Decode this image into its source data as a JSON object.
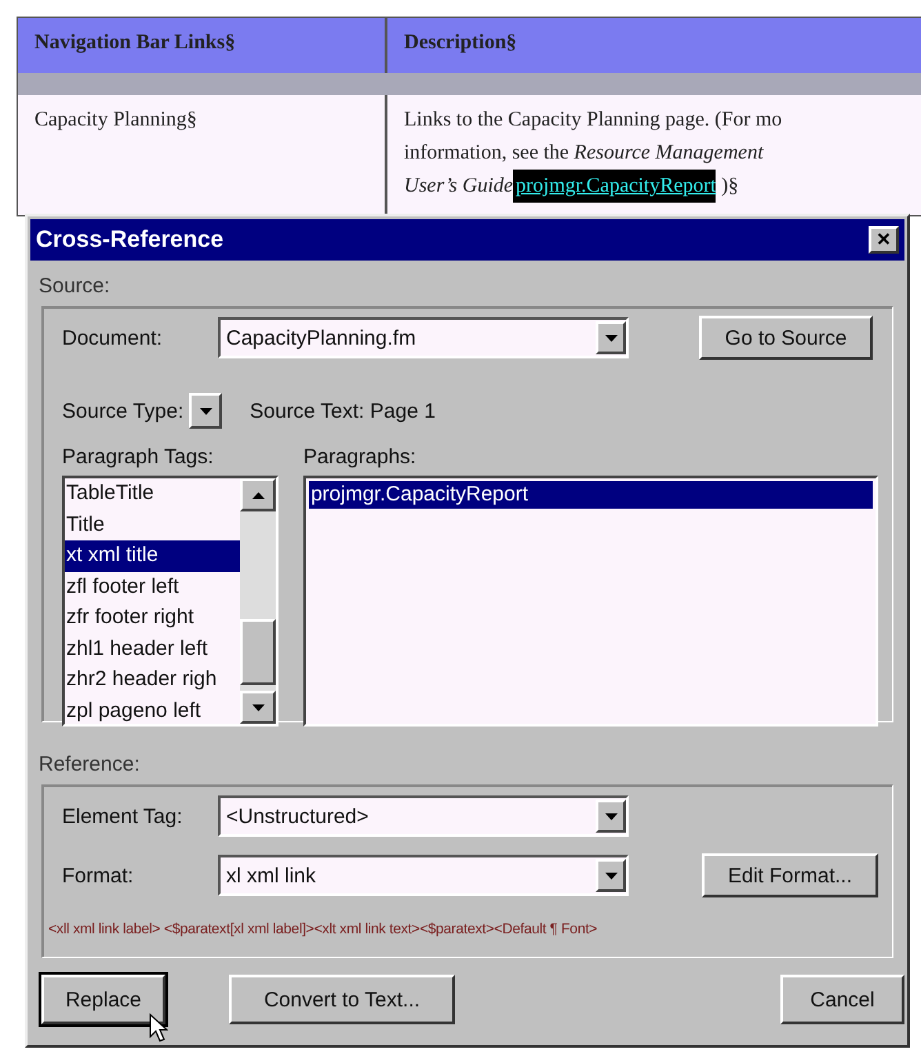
{
  "table": {
    "columns": [
      "Navigation Bar Links§",
      "Description§"
    ],
    "row": {
      "name": "Capacity Planning§",
      "description_lines": [
        "Links to the Capacity Planning page. (For mo",
        "information, see the *Resource Management*"
      ],
      "guide": "User’s Guide",
      "marker": "projmgr.CapacityReport",
      "end": " )§"
    }
  },
  "dialog": {
    "title": "Cross-Reference",
    "close": "✕",
    "source": {
      "label": "Source:",
      "document_label": "Document:",
      "document": "CapacityPlanning.fm",
      "go_button": "Go to Source",
      "source_type_label": "Source Type:",
      "source_text": "Source Text:  Page  1",
      "tags_label": "Paragraph Tags:",
      "paragraphs_label": "Paragraphs:",
      "tags": [
        {
          "text": "TableTitle",
          "selected": false
        },
        {
          "text": "Title",
          "selected": false
        },
        {
          "text": "xt xml title",
          "selected": true
        },
        {
          "text": "zfl footer left",
          "selected": false
        },
        {
          "text": "zfr footer right",
          "selected": false
        },
        {
          "text": "zhl1 header left",
          "selected": false
        },
        {
          "text": "zhr2 header righ",
          "selected": false
        },
        {
          "text": "zpl pageno left",
          "selected": false
        }
      ],
      "paragraphs": [
        {
          "text": "projmgr.CapacityReport",
          "selected": true
        }
      ]
    },
    "reference": {
      "label": "Reference:",
      "element_tag_label": "Element Tag:",
      "element_tag": "<Unstructured>",
      "format_label": "Format:",
      "format": "xl xml link",
      "edit_button": "Edit Format...",
      "format_string": "<xll xml link label> <$paratext[xl xml label]><xlt xml link text><$paratext><Default ¶ Font>"
    },
    "buttons": [
      {
        "label": "Replace",
        "focused": true
      },
      {
        "label": "Convert to Text...",
        "focused": false
      },
      {
        "label": "Cancel",
        "focused": false
      }
    ]
  }
}
